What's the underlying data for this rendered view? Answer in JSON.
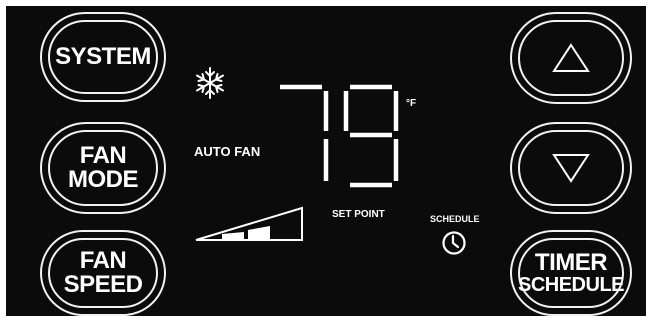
{
  "controls": {
    "system_label": "SYSTEM",
    "fan_mode_line1": "FAN",
    "fan_mode_line2": "MODE",
    "fan_speed_line1": "FAN",
    "fan_speed_line2": "SPEED",
    "timer_line1": "TIMER",
    "timer_line2": "SCHEDULE"
  },
  "display": {
    "mode_icon": "snowflake-icon",
    "fan_status": "AUTO FAN",
    "temperature": "79",
    "unit": "°F",
    "set_point_label": "SET POINT",
    "schedule_label": "SCHEDULE",
    "schedule_icon": "clock-icon",
    "fan_speed_level": "2/3",
    "fan_speed_icon": "fan-speed-bars-icon"
  },
  "arrows": {
    "up_icon": "up-arrow-icon",
    "down_icon": "down-arrow-icon"
  },
  "colors": {
    "panel_background": "#0b0b0b",
    "foreground": "#ffffff"
  }
}
